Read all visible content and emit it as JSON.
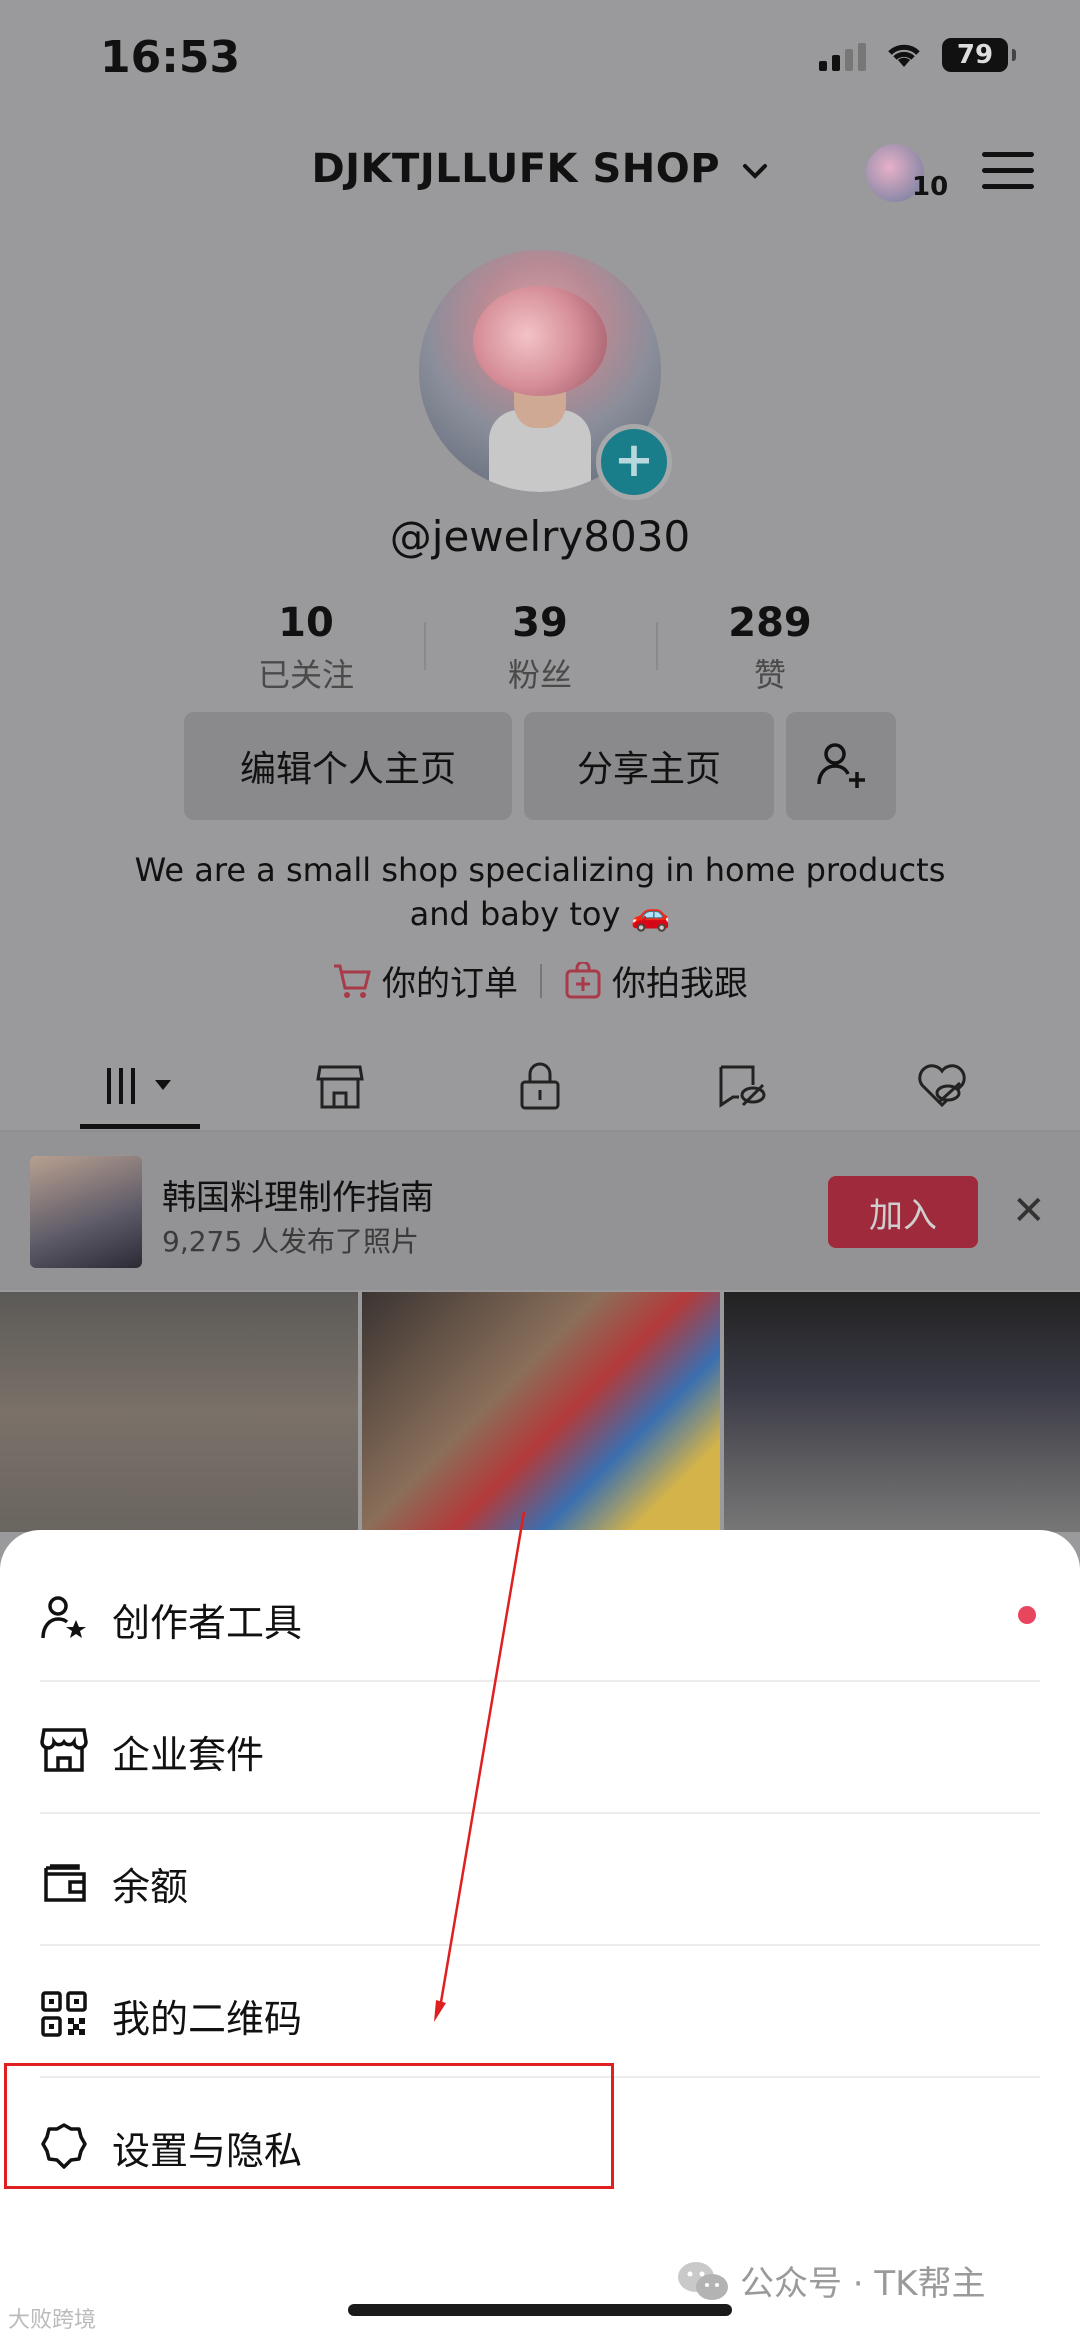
{
  "status_bar": {
    "time": "16:53",
    "battery": "79"
  },
  "header": {
    "shop_name": "DJKTJLLUFK SHOP",
    "notification_count": "10"
  },
  "profile": {
    "username": "@jewelry8030",
    "stats": [
      {
        "value": "10",
        "label": "已关注"
      },
      {
        "value": "39",
        "label": "粉丝"
      },
      {
        "value": "289",
        "label": "赞"
      }
    ],
    "edit_button": "编辑个人主页",
    "share_button": "分享主页",
    "bio_line1": "We are a small shop specializing in home products",
    "bio_line2": "and baby toy 🚗",
    "orders_link": "你的订单",
    "shoot_link": "你拍我跟"
  },
  "banner": {
    "title": "韩国料理制作指南",
    "subtitle": "9,275 人发布了照片",
    "join_button": "加入"
  },
  "tabs": [
    "grid-icon",
    "shop-icon",
    "lock-icon",
    "repost-icon",
    "liked-icon"
  ],
  "sheet": {
    "items": [
      {
        "label": "创作者工具",
        "icon": "creator-star-icon"
      },
      {
        "label": "企业套件",
        "icon": "store-icon"
      },
      {
        "label": "余额",
        "icon": "wallet-icon"
      },
      {
        "label": "我的二维码",
        "icon": "qr-code-icon"
      },
      {
        "label": "设置与隐私",
        "icon": "gear-icon"
      }
    ]
  },
  "watermark": "公众号 · TK帮主",
  "corner_watermark": "大败跨境",
  "colors": {
    "accent_red": "#e8455e",
    "join_red": "#9e2a3b",
    "annotation_red": "#e02020"
  }
}
